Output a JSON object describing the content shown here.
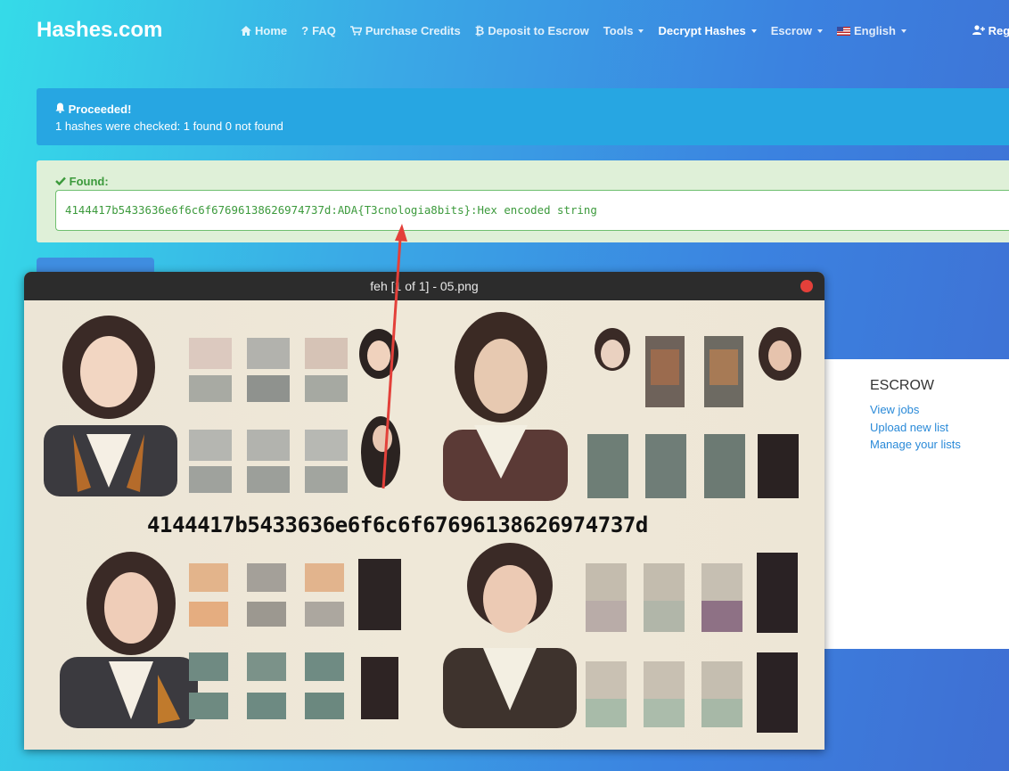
{
  "navbar": {
    "brand": "Hashes.com",
    "items": [
      {
        "icon": "home-icon",
        "label": "Home"
      },
      {
        "icon": "question-icon",
        "label": "FAQ"
      },
      {
        "icon": "cart-icon",
        "label": "Purchase Credits"
      },
      {
        "icon": "bitcoin-icon",
        "label": "Deposit to Escrow"
      },
      {
        "label": "Tools"
      },
      {
        "label": "Decrypt Hashes"
      },
      {
        "label": "Escrow"
      },
      {
        "icon": "us-flag-icon",
        "label": "English"
      }
    ],
    "register_label": "Reg"
  },
  "alert_info": {
    "title": "Proceeded!",
    "message": "1 hashes were checked: 1 found 0 not found"
  },
  "found": {
    "title": "Found:",
    "result": "4144417b5433636e6f6c6f67696138626974737d:ADA{T3cnologia8bits}:Hex encoded string"
  },
  "escrow_panel": {
    "title": "ESCROW",
    "links": [
      "View jobs",
      "Upload new list",
      "Manage your lists"
    ]
  },
  "feh_window": {
    "title": "feh [1 of 1] - 05.png",
    "image_text": "4144417b5433636e6f6c6f67696138626974737d"
  },
  "colors": {
    "accent": "#27a6e2",
    "success_bg": "#dff0d8",
    "success_text": "#3c9a3c",
    "arrow": "#e3403a"
  }
}
